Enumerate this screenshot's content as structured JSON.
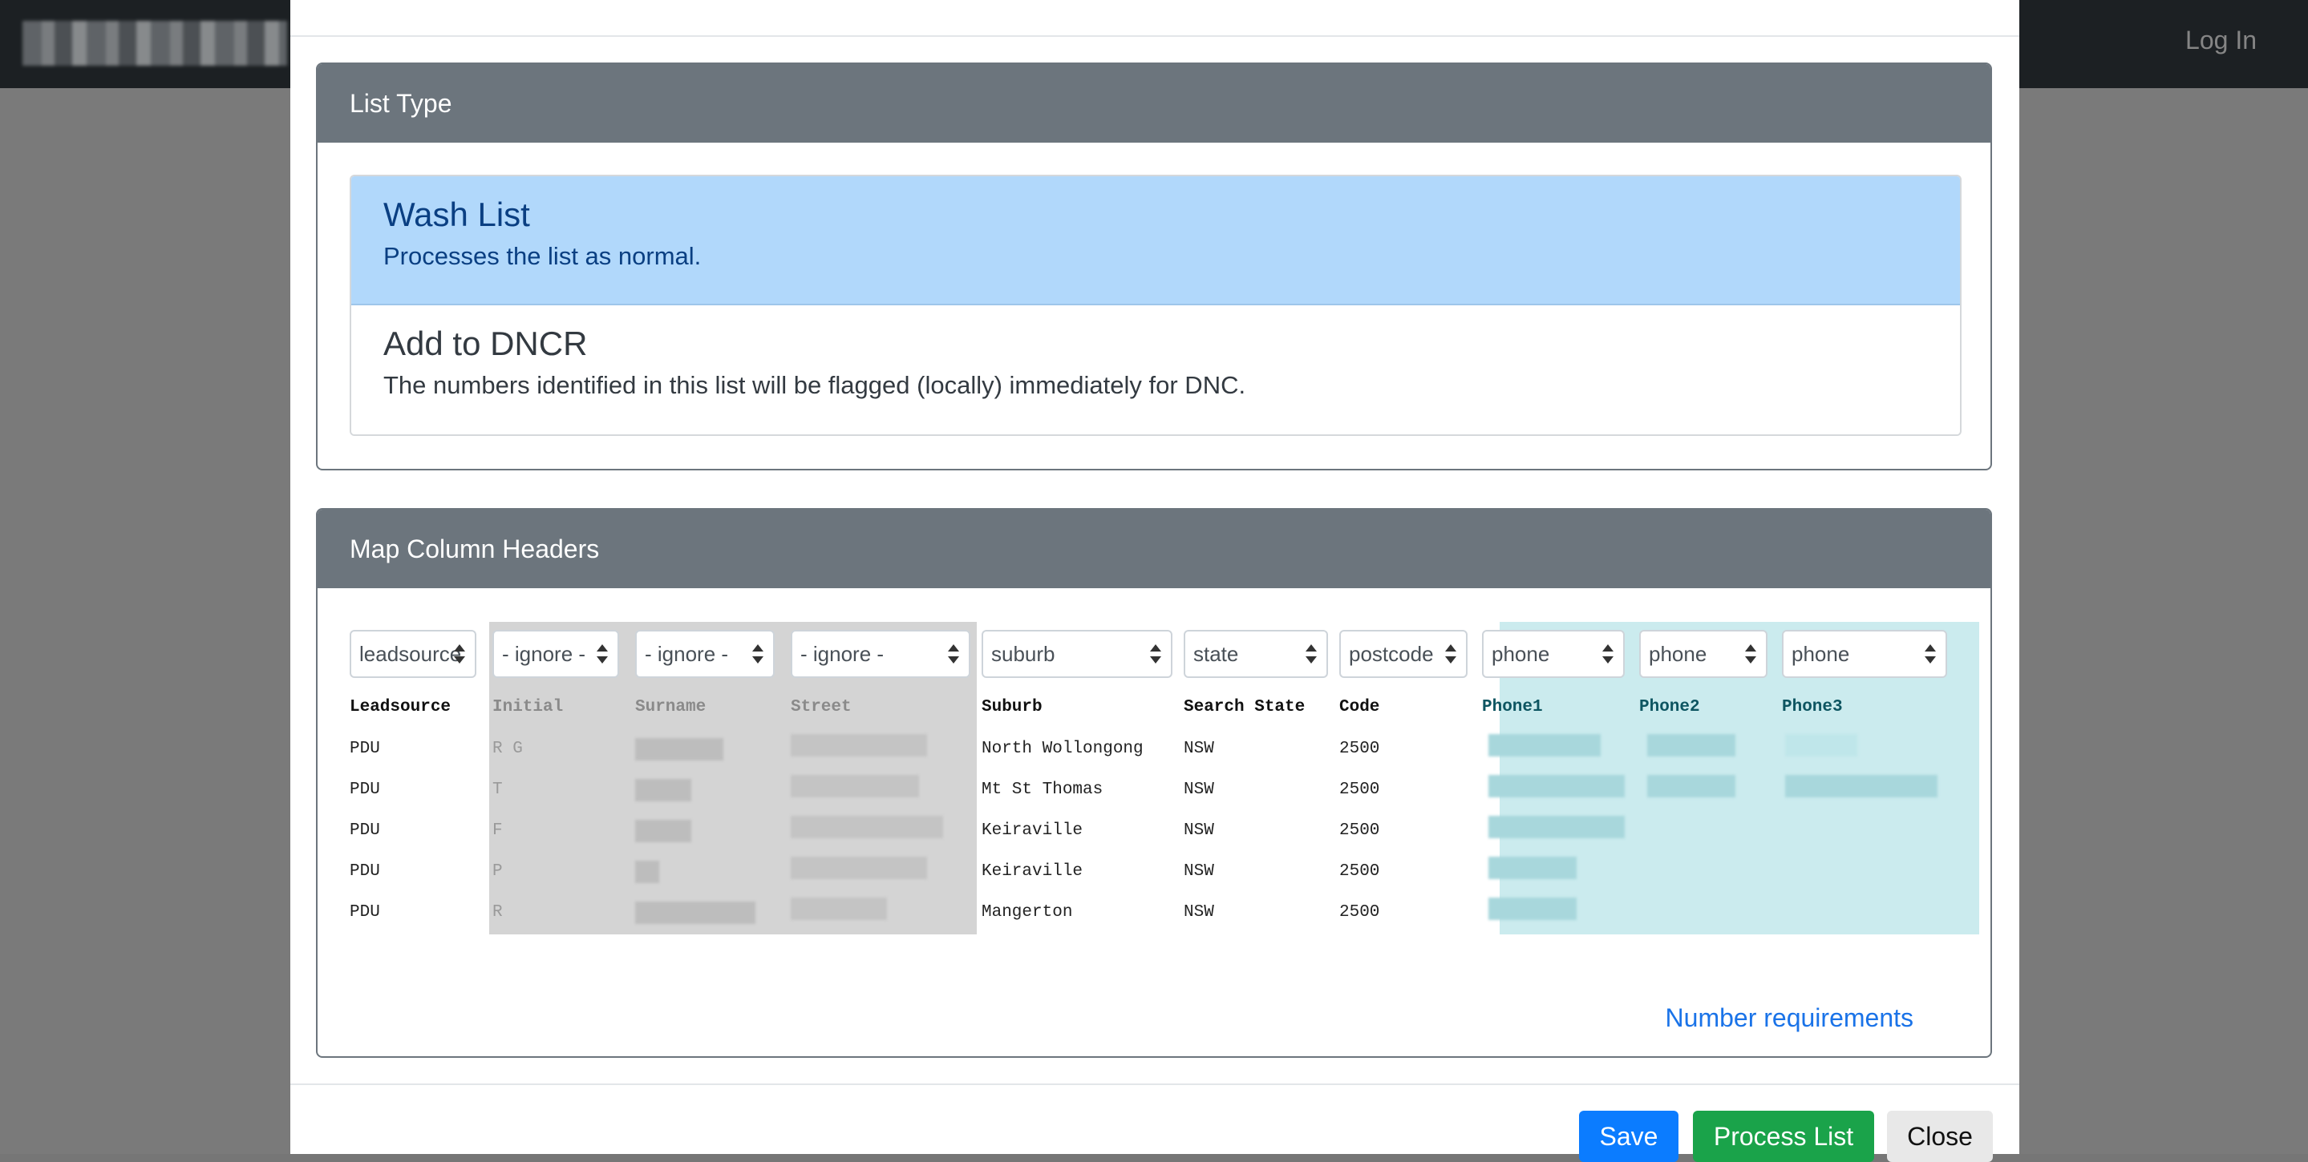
{
  "navbar": {
    "login": "Log In"
  },
  "list_type": {
    "title": "List Type",
    "options": [
      {
        "title": "Wash List",
        "desc": "Processes the list as normal."
      },
      {
        "title": "Add to DNCR",
        "desc": "The numbers identified in this list will be flagged (locally) immediately for DNC."
      }
    ]
  },
  "map_columns": {
    "title": "Map Column Headers",
    "selects": [
      "leadsource",
      "- ignore -",
      "- ignore -",
      "- ignore -",
      "suburb",
      "state",
      "postcode",
      "phone",
      "phone",
      "phone"
    ],
    "headers": [
      "Leadsource",
      "Initial",
      "Surname",
      "Street",
      "Suburb",
      "Search State",
      "Code",
      "Phone1",
      "Phone2",
      "Phone3"
    ],
    "rows": [
      {
        "leadsource": "PDU",
        "initial": "R G",
        "suburb": "North Wollongong",
        "state": "NSW",
        "code": "2500"
      },
      {
        "leadsource": "PDU",
        "initial": "T",
        "suburb": "Mt St Thomas",
        "state": "NSW",
        "code": "2500"
      },
      {
        "leadsource": "PDU",
        "initial": "F",
        "suburb": "Keiraville",
        "state": "NSW",
        "code": "2500"
      },
      {
        "leadsource": "PDU",
        "initial": "P",
        "suburb": "Keiraville",
        "state": "NSW",
        "code": "2500"
      },
      {
        "leadsource": "PDU",
        "initial": "R",
        "suburb": "Mangerton",
        "state": "NSW",
        "code": "2500"
      }
    ],
    "link": "Number requirements"
  },
  "footer": {
    "save": "Save",
    "process": "Process List",
    "close": "Close"
  },
  "colors": {
    "primary": "#0b7cff",
    "success": "#1aa34a",
    "card_header": "#6c757d",
    "active_item": "#b1d8fb"
  }
}
